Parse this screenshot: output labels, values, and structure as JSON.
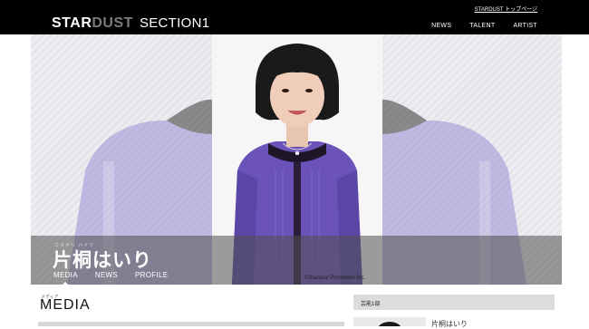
{
  "header": {
    "logo_star": "STAR",
    "logo_dust": "DUST",
    "logo_section": "SECTION1",
    "top_link": "STARDUST トップページ",
    "nav": [
      "NEWS",
      "TALENT",
      "ARTIST"
    ]
  },
  "hero": {
    "name_kana": "カタギリ ハイリ",
    "name": "片桐はいり",
    "tabs": [
      "MEDIA",
      "NEWS",
      "PROFILE"
    ],
    "active_tab": "MEDIA",
    "copyright": "©Stardust Promotion Inc."
  },
  "content": {
    "section_kana": "メディア",
    "section_title": "MEDIA"
  },
  "sidebar": {
    "heading": "芸能1部",
    "item_name": "片桐はいり"
  },
  "colors": {
    "header_bg": "#000000",
    "cardigan": "#6a52b8",
    "hair": "#1a1a1a"
  }
}
